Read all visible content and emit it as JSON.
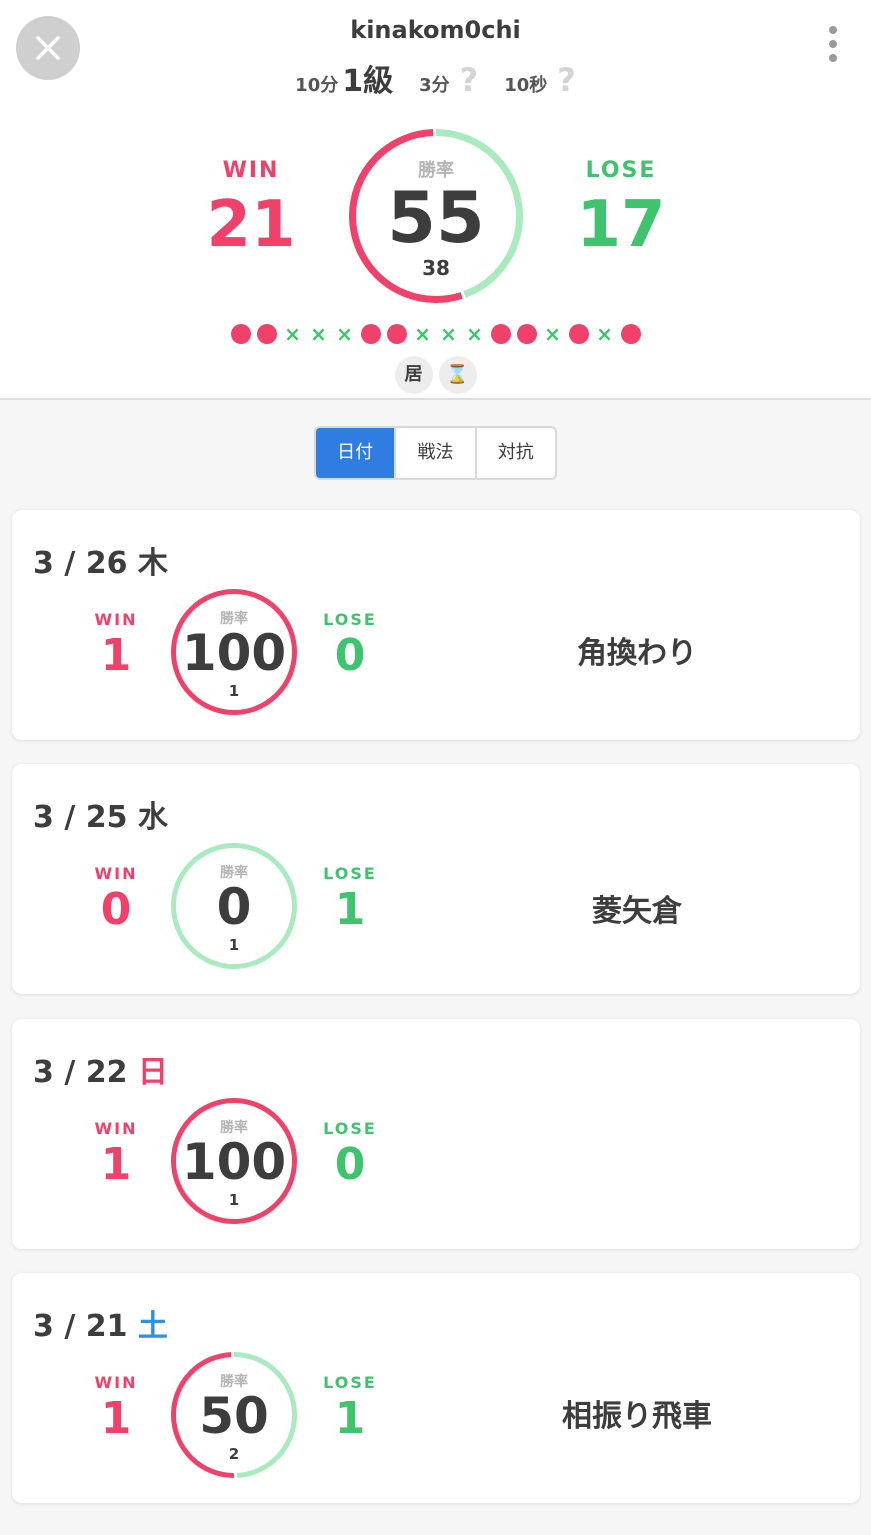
{
  "header": {
    "username": "kinakom0chi",
    "ranks": [
      {
        "label": "10分",
        "value": "1級",
        "known": true
      },
      {
        "label": "3分",
        "value": "?",
        "known": false
      },
      {
        "label": "10秒",
        "value": "?",
        "known": false
      }
    ],
    "summary": {
      "win_label": "WIN",
      "lose_label": "LOSE",
      "wins": "21",
      "losses": "17",
      "rate_label": "勝率",
      "rate": "55",
      "total": "38",
      "rate_fraction": 0.55
    },
    "recent_results": [
      "win",
      "win",
      "lose",
      "lose",
      "lose",
      "win",
      "win",
      "lose",
      "lose",
      "lose",
      "win",
      "win",
      "lose",
      "win",
      "lose",
      "win"
    ],
    "lose_symbol": "×",
    "tags": [
      "居",
      "⌛"
    ]
  },
  "tabs": [
    {
      "label": "日付",
      "active": true
    },
    {
      "label": "戦法",
      "active": false
    },
    {
      "label": "対抗",
      "active": false
    }
  ],
  "colors": {
    "win": "#f0416a",
    "lose": "#3fc46d",
    "lose_ring": "#a9eabf",
    "accent": "#2f7de1",
    "sunday": "#f0416a",
    "saturday": "#2f8fe0"
  },
  "cards": [
    {
      "date": "3 / 26 ",
      "weekday": "木",
      "weekday_type": "normal",
      "win_label": "WIN",
      "lose_label": "LOSE",
      "wins": "1",
      "losses": "0",
      "rate_label": "勝率",
      "rate": "100",
      "total": "1",
      "rate_fraction": 1.0,
      "strategy": "角換わり"
    },
    {
      "date": "3 / 25 ",
      "weekday": "水",
      "weekday_type": "normal",
      "win_label": "WIN",
      "lose_label": "LOSE",
      "wins": "0",
      "losses": "1",
      "rate_label": "勝率",
      "rate": "0",
      "total": "1",
      "rate_fraction": 0.0,
      "strategy": "菱矢倉"
    },
    {
      "date": "3 / 22 ",
      "weekday": "日",
      "weekday_type": "sunday",
      "win_label": "WIN",
      "lose_label": "LOSE",
      "wins": "1",
      "losses": "0",
      "rate_label": "勝率",
      "rate": "100",
      "total": "1",
      "rate_fraction": 1.0,
      "strategy": ""
    },
    {
      "date": "3 / 21 ",
      "weekday": "土",
      "weekday_type": "saturday",
      "win_label": "WIN",
      "lose_label": "LOSE",
      "wins": "1",
      "losses": "1",
      "rate_label": "勝率",
      "rate": "50",
      "total": "2",
      "rate_fraction": 0.5,
      "strategy": "相振り飛車"
    }
  ]
}
